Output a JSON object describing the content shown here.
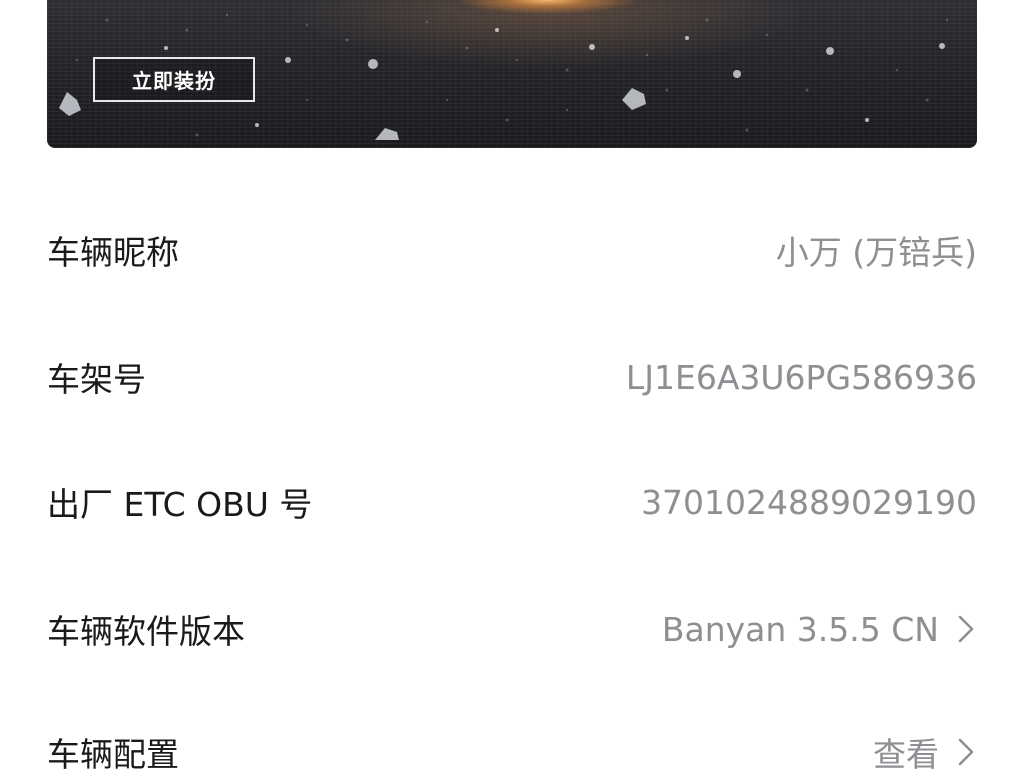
{
  "banner": {
    "dress_button_label": "立即装扮"
  },
  "vehicle_info": {
    "nickname": {
      "label": "车辆昵称",
      "value": "小万 (万锫兵)"
    },
    "vin": {
      "label": "车架号",
      "value": "LJ1E6A3U6PG586936"
    },
    "etc_obu": {
      "label": "出厂 ETC OBU 号",
      "value": "3701024889029190"
    },
    "software_version": {
      "label": "车辆软件版本",
      "value": "Banyan 3.5.5 CN"
    },
    "configuration": {
      "label": "车辆配置",
      "value": "查看"
    }
  },
  "icons": {
    "chevron": "chevron-right-icon"
  },
  "colors": {
    "label_text": "#1a1a1a",
    "value_text": "#8e8e93",
    "background": "#ffffff"
  }
}
